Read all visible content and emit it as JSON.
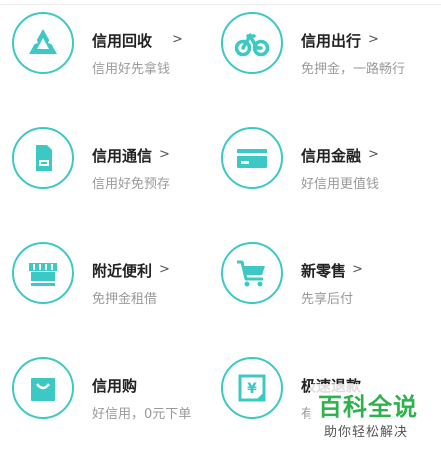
{
  "services": [
    {
      "title": "信用回收",
      "arrow": ">",
      "subtitle": "信用好先拿钱",
      "icon": "recycle-icon"
    },
    {
      "title": "信用出行",
      "arrow": ">",
      "subtitle": "免押金，一路畅行",
      "icon": "bicycle-icon"
    },
    {
      "title": "信用通信",
      "arrow": ">",
      "subtitle": "信用好免预存",
      "icon": "sim-card-icon"
    },
    {
      "title": "信用金融",
      "arrow": ">",
      "subtitle": "好信用更值钱",
      "icon": "credit-card-icon"
    },
    {
      "title": "附近便利",
      "arrow": ">",
      "subtitle": "免押金租借",
      "icon": "store-icon"
    },
    {
      "title": "新零售",
      "arrow": ">",
      "subtitle": "先享后付",
      "icon": "shopping-cart-icon"
    },
    {
      "title": "信用购",
      "arrow": "",
      "subtitle": "好信用，0元下单",
      "icon": "shopping-bag-icon"
    },
    {
      "title": "极速退款",
      "arrow": "",
      "subtitle": "有",
      "icon": "refund-yen-icon"
    }
  ],
  "watermark": {
    "title": "百科全说",
    "tagline": "助你轻松解决"
  },
  "colors": {
    "accent": "#3cc8c4",
    "watermark_green": "#2fb24d"
  }
}
